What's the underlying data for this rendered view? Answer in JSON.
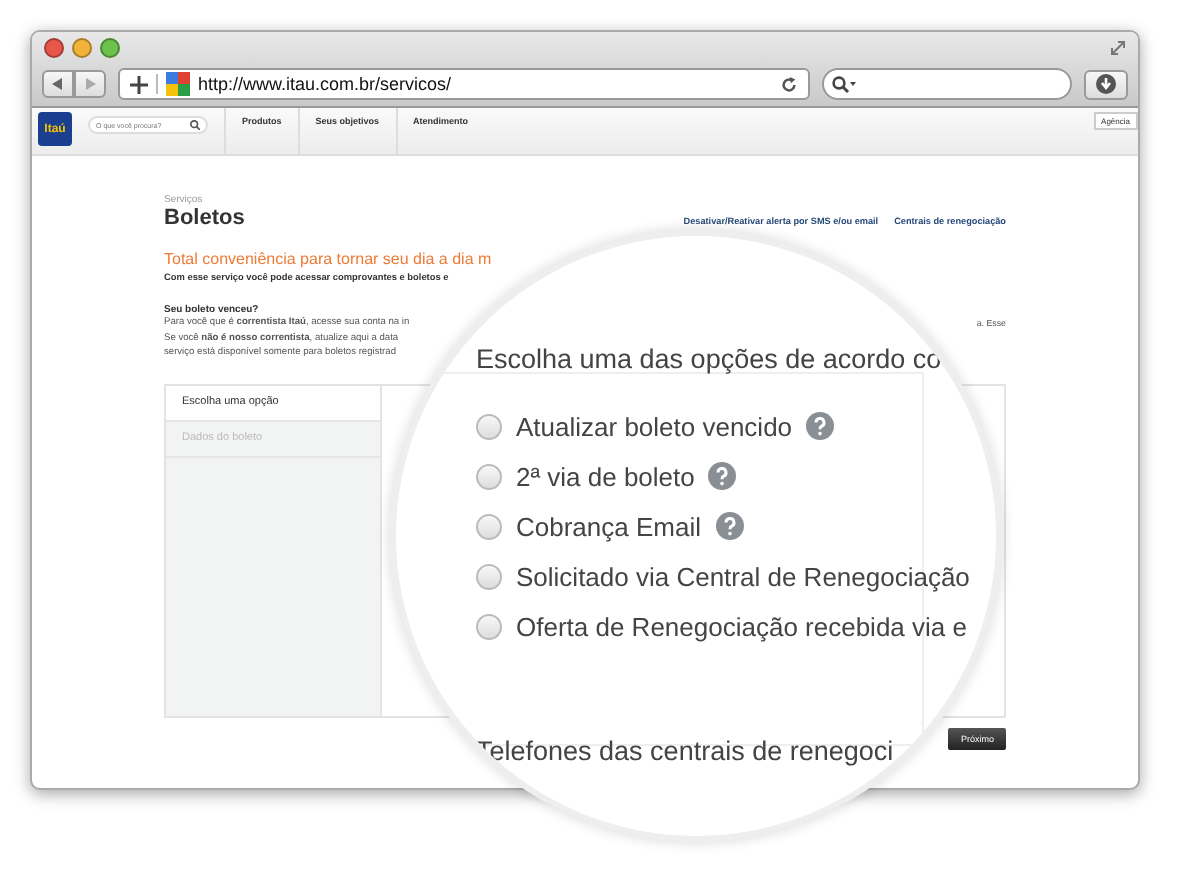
{
  "browser": {
    "url": "http://www.itau.com.br/servicos/"
  },
  "site_nav": {
    "logo": "Itaú",
    "search": {
      "placeholder": "O que você procura?"
    },
    "items": [
      "Produtos",
      "Seus objetivos",
      "Atendimento"
    ],
    "agency_button": "Agência"
  },
  "page": {
    "breadcrumb": "Serviços",
    "title": "Boletos",
    "links": [
      "Desativar/Reativar alerta por SMS e/ou email",
      "Centrais de renegociação"
    ],
    "headline": "Total conveniência para tornar seu dia a dia m",
    "subtitle": "Com esse serviço você pode acessar comprovantes e boletos e",
    "notice_title": "Seu boleto venceu?",
    "notice_lines": [
      "Para você que é **correntista Itaú**, acesse sua conta na in",
      "Se você **não é nosso correntista**, atualize aqui a data",
      "serviço está disponível somente para boletos registrad"
    ],
    "notice_fragment": "a. Esse",
    "steps": [
      {
        "label": "Escolha uma opção",
        "selected": true
      },
      {
        "label": "Dados do boleto",
        "selected": false
      }
    ],
    "next_button": "Próximo"
  },
  "magnifier": {
    "heading": "Escolha uma das opções de acordo co",
    "options": [
      {
        "label": "Atualizar boleto vencido",
        "help": true,
        "selected": false
      },
      {
        "label": "2ª via de boleto",
        "help": true,
        "selected": false
      },
      {
        "label": "Cobrança Email",
        "help": true,
        "selected": false
      },
      {
        "label": "Solicitado via Central de Renegociação",
        "help": false,
        "selected": false
      },
      {
        "label": "Oferta de Renegociação recebida via e",
        "help": false,
        "selected": false
      }
    ],
    "footer": "Telefones das centrais de renegoci"
  }
}
